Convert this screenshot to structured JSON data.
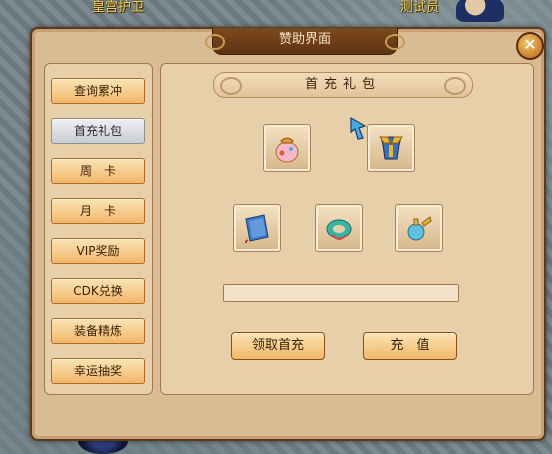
{
  "topbar": {
    "left_text": "皇宫护卫",
    "right_text": "测试员"
  },
  "window": {
    "title": "赞助界面",
    "close_label": "✕"
  },
  "sidebar": {
    "items": [
      {
        "label": "查询累冲"
      },
      {
        "label": "首充礼包"
      },
      {
        "label": "周　卡"
      },
      {
        "label": "月　卡"
      },
      {
        "label": "VIP奖励"
      },
      {
        "label": "CDK兑换"
      },
      {
        "label": "装备精炼"
      },
      {
        "label": "幸运抽奖"
      }
    ],
    "active_index": 1
  },
  "content": {
    "banner_title": "首充礼包",
    "items": [
      {
        "icon": "gift-bag-icon"
      },
      {
        "icon": "armor-icon"
      },
      {
        "icon": "book-icon"
      },
      {
        "icon": "jade-ring-icon"
      },
      {
        "icon": "potion-icon"
      }
    ],
    "input_value": "",
    "claim_button": "领取首充",
    "recharge_button": "充　值"
  },
  "colors": {
    "panel": "#d9bb94",
    "title_bar": "#6b3b17",
    "button": "#f0b86a",
    "active_button": "#c9ccd1"
  }
}
